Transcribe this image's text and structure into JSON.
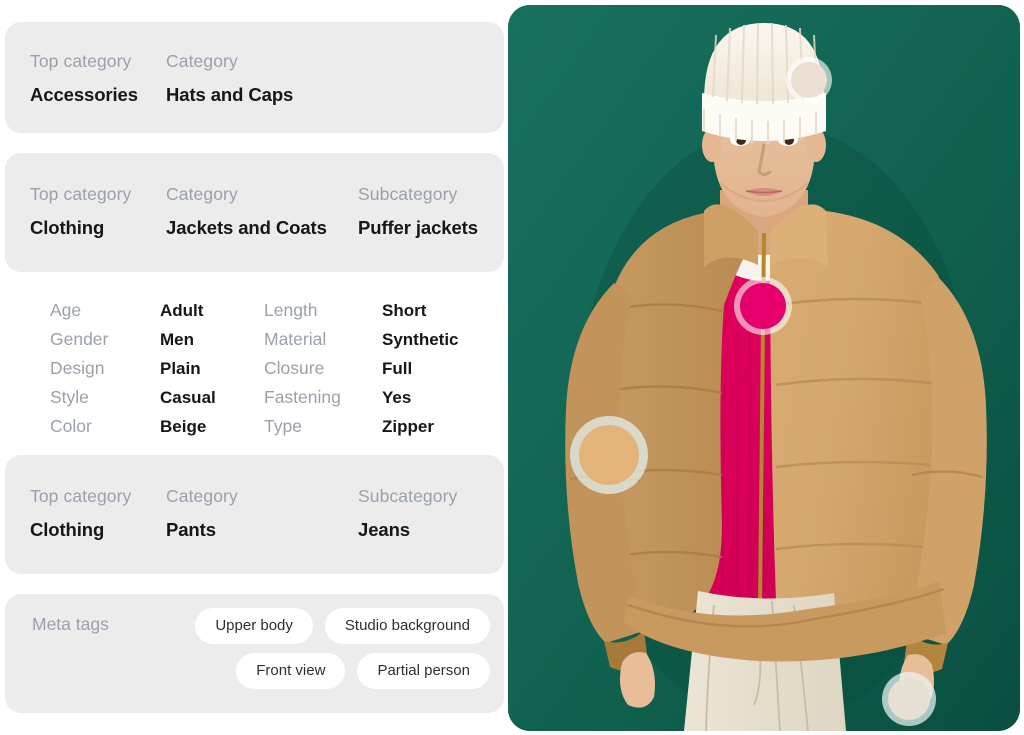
{
  "cards": [
    {
      "id": "accessories-card",
      "fields": [
        {
          "label": "Top category",
          "value": "Accessories"
        },
        {
          "label": "Category",
          "value": "Hats and Caps"
        }
      ]
    },
    {
      "id": "clothing-jacket-card",
      "fields": [
        {
          "label": "Top category",
          "value": "Clothing"
        },
        {
          "label": "Category",
          "value": "Jackets and Coats"
        },
        {
          "label": "Subcategory",
          "value": "Puffer jackets"
        }
      ]
    },
    {
      "id": "clothing-pants-card",
      "fields": [
        {
          "label": "Top category",
          "value": "Clothing"
        },
        {
          "label": "Category",
          "value": "Pants"
        },
        {
          "label": "Subcategory",
          "value": "Jeans"
        }
      ]
    }
  ],
  "attributes": {
    "column_a": [
      {
        "label": "Age",
        "value": "Adult"
      },
      {
        "label": "Gender",
        "value": "Men"
      },
      {
        "label": "Design",
        "value": "Plain"
      },
      {
        "label": "Style",
        "value": "Casual"
      },
      {
        "label": "Color",
        "value": "Beige"
      }
    ],
    "column_b": [
      {
        "label": "Length",
        "value": "Short"
      },
      {
        "label": "Material",
        "value": "Synthetic"
      },
      {
        "label": "Closure",
        "value": "Full"
      },
      {
        "label": "Fastening",
        "value": "Yes"
      },
      {
        "label": "Type",
        "value": "Zipper"
      }
    ]
  },
  "meta": {
    "label": "Meta tags",
    "tags": [
      "Upper body",
      "Studio background",
      "Front view",
      "Partial person"
    ]
  },
  "photo": {
    "alt_name": "model-photo",
    "background_color": "#116354",
    "markers": [
      {
        "name": "hat-marker",
        "color": "#eadfd0"
      },
      {
        "name": "sweater-marker",
        "color": "#e5006e"
      },
      {
        "name": "jacket-marker",
        "color": "#e3b37a"
      },
      {
        "name": "jeans-marker",
        "color": "#e6e0d3"
      }
    ]
  },
  "colors": {
    "card_background": "#ececec",
    "label_text": "#9aa1ad",
    "value_text": "#15171a",
    "tag_background": "#ffffff",
    "page_background": "#ffffff"
  }
}
